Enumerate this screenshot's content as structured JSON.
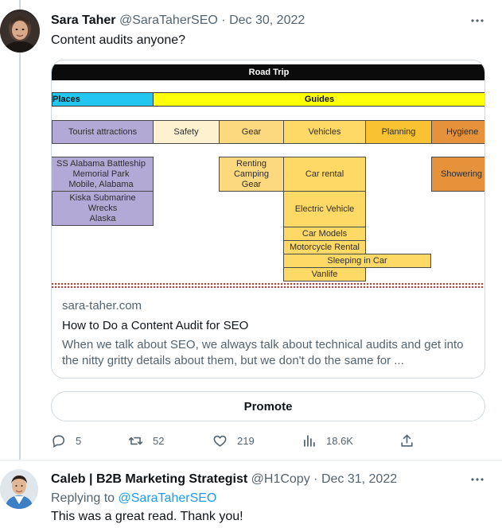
{
  "tweet": {
    "author_name": "Sara Taher",
    "handle": "@SaraTaherSEO",
    "separator": "·",
    "date": "Dec 30, 2022",
    "text": "Content audits anyone?",
    "card": {
      "image": {
        "title": "Road Trip",
        "places_label": "Places",
        "guides_label": "Guides",
        "categories": [
          "Tourist attractions",
          "Safety",
          "Gear",
          "Vehicles",
          "Planning",
          "Hygiene"
        ],
        "places_items": [
          "SS Alabama Battleship\nMemorial Park\nMobile, Alabama",
          "Kiska Submarine\nWrecks\nAlaska"
        ],
        "gear_items": [
          "Renting\nCamping\nGear"
        ],
        "vehicle_items": [
          "Car rental",
          "Electric Vehicle",
          "Car Models",
          "Motorcycle Rental",
          "Sleeping in Car",
          "Vanlife"
        ],
        "hygiene_items": [
          "Showering"
        ],
        "colors": {
          "places": "#22c6f0",
          "guides": "#ffff0a",
          "purple": "#b3a9d6",
          "safety": "#fdf1cf",
          "gear": "#fcd87e",
          "vehicles": "#ffd966",
          "planning": "#f8c232",
          "hygiene": "#e6923a"
        }
      },
      "domain": "sara-taher.com",
      "title": "How to Do a Content Audit for SEO",
      "description": "When we talk about SEO, we always talk about technical audits and get into the nitty gritty details about them, but we don't do the same for ..."
    },
    "promote_label": "Promote",
    "actions": {
      "replies": "5",
      "retweets": "52",
      "likes": "219",
      "views": "18.6K"
    }
  },
  "reply": {
    "author_name": "Caleb | B2B Marketing Strategist",
    "handle": "@H1Copy",
    "separator": "·",
    "date": "Dec 31, 2022",
    "replying_prefix": "Replying to",
    "replying_to": "@SaraTaherSEO",
    "text": "This was a great read. Thank you!"
  },
  "icons": [
    "more-icon",
    "reply-icon",
    "retweet-icon",
    "like-icon",
    "views-icon",
    "share-icon"
  ]
}
